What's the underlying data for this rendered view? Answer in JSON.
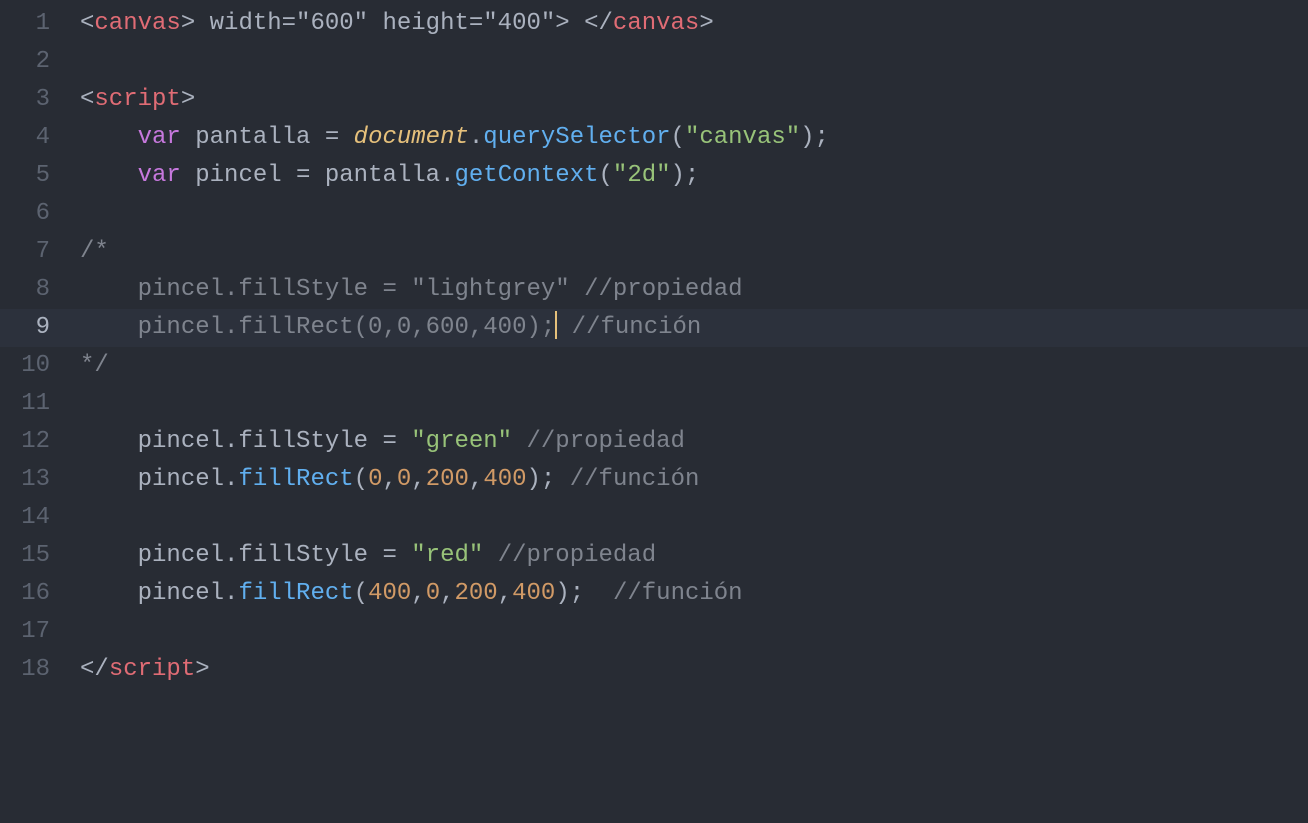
{
  "editor": {
    "activeLine": 9,
    "lines": [
      {
        "num": "1",
        "tokens": [
          {
            "cls": "t-punct",
            "text": "<"
          },
          {
            "cls": "t-tag",
            "text": "canvas"
          },
          {
            "cls": "t-punct",
            "text": ">"
          },
          {
            "cls": "t-default",
            "text": " width=\"600\" height=\"400\"> "
          },
          {
            "cls": "t-punct",
            "text": "</"
          },
          {
            "cls": "t-tag",
            "text": "canvas"
          },
          {
            "cls": "t-punct",
            "text": ">"
          }
        ]
      },
      {
        "num": "2",
        "tokens": []
      },
      {
        "num": "3",
        "tokens": [
          {
            "cls": "t-punct",
            "text": "<"
          },
          {
            "cls": "t-tag",
            "text": "script"
          },
          {
            "cls": "t-punct",
            "text": ">"
          }
        ]
      },
      {
        "num": "4",
        "tokens": [
          {
            "cls": "t-default",
            "text": "    "
          },
          {
            "cls": "t-keyword",
            "text": "var"
          },
          {
            "cls": "t-default",
            "text": " pantalla "
          },
          {
            "cls": "t-punct",
            "text": "="
          },
          {
            "cls": "t-default",
            "text": " "
          },
          {
            "cls": "t-builtin",
            "text": "document"
          },
          {
            "cls": "t-punct",
            "text": "."
          },
          {
            "cls": "t-method",
            "text": "querySelector"
          },
          {
            "cls": "t-punct",
            "text": "("
          },
          {
            "cls": "t-string",
            "text": "\"canvas\""
          },
          {
            "cls": "t-punct",
            "text": ");"
          }
        ]
      },
      {
        "num": "5",
        "tokens": [
          {
            "cls": "t-default",
            "text": "    "
          },
          {
            "cls": "t-keyword",
            "text": "var"
          },
          {
            "cls": "t-default",
            "text": " pincel "
          },
          {
            "cls": "t-punct",
            "text": "="
          },
          {
            "cls": "t-default",
            "text": " pantalla"
          },
          {
            "cls": "t-punct",
            "text": "."
          },
          {
            "cls": "t-method",
            "text": "getContext"
          },
          {
            "cls": "t-punct",
            "text": "("
          },
          {
            "cls": "t-string",
            "text": "\"2d\""
          },
          {
            "cls": "t-punct",
            "text": ");"
          }
        ]
      },
      {
        "num": "6",
        "tokens": []
      },
      {
        "num": "7",
        "tokens": [
          {
            "cls": "t-comment",
            "text": "/*"
          }
        ]
      },
      {
        "num": "8",
        "tokens": [
          {
            "cls": "t-comment",
            "text": "    pincel.fillStyle = \"lightgrey\" //propiedad"
          }
        ]
      },
      {
        "num": "9",
        "cursorAfter": 5,
        "tokens": [
          {
            "cls": "t-comment",
            "text": "    pincel.fillRect(0,0,600,400);"
          },
          {
            "cls": "cursor",
            "text": ""
          },
          {
            "cls": "t-comment",
            "text": " //función"
          }
        ]
      },
      {
        "num": "10",
        "tokens": [
          {
            "cls": "t-comment",
            "text": "*/"
          }
        ]
      },
      {
        "num": "11",
        "tokens": []
      },
      {
        "num": "12",
        "tokens": [
          {
            "cls": "t-default",
            "text": "    pincel.fillStyle "
          },
          {
            "cls": "t-punct",
            "text": "="
          },
          {
            "cls": "t-default",
            "text": " "
          },
          {
            "cls": "t-string",
            "text": "\"green\""
          },
          {
            "cls": "t-default",
            "text": " "
          },
          {
            "cls": "t-comment",
            "text": "//propiedad"
          }
        ]
      },
      {
        "num": "13",
        "tokens": [
          {
            "cls": "t-default",
            "text": "    pincel"
          },
          {
            "cls": "t-punct",
            "text": "."
          },
          {
            "cls": "t-method",
            "text": "fillRect"
          },
          {
            "cls": "t-punct",
            "text": "("
          },
          {
            "cls": "t-number",
            "text": "0"
          },
          {
            "cls": "t-punct",
            "text": ","
          },
          {
            "cls": "t-number",
            "text": "0"
          },
          {
            "cls": "t-punct",
            "text": ","
          },
          {
            "cls": "t-number",
            "text": "200"
          },
          {
            "cls": "t-punct",
            "text": ","
          },
          {
            "cls": "t-number",
            "text": "400"
          },
          {
            "cls": "t-punct",
            "text": "); "
          },
          {
            "cls": "t-comment",
            "text": "//función"
          }
        ]
      },
      {
        "num": "14",
        "tokens": []
      },
      {
        "num": "15",
        "tokens": [
          {
            "cls": "t-default",
            "text": "    pincel.fillStyle "
          },
          {
            "cls": "t-punct",
            "text": "="
          },
          {
            "cls": "t-default",
            "text": " "
          },
          {
            "cls": "t-string",
            "text": "\"red\""
          },
          {
            "cls": "t-default",
            "text": " "
          },
          {
            "cls": "t-comment",
            "text": "//propiedad"
          }
        ]
      },
      {
        "num": "16",
        "tokens": [
          {
            "cls": "t-default",
            "text": "    pincel"
          },
          {
            "cls": "t-punct",
            "text": "."
          },
          {
            "cls": "t-method",
            "text": "fillRect"
          },
          {
            "cls": "t-punct",
            "text": "("
          },
          {
            "cls": "t-number",
            "text": "400"
          },
          {
            "cls": "t-punct",
            "text": ","
          },
          {
            "cls": "t-number",
            "text": "0"
          },
          {
            "cls": "t-punct",
            "text": ","
          },
          {
            "cls": "t-number",
            "text": "200"
          },
          {
            "cls": "t-punct",
            "text": ","
          },
          {
            "cls": "t-number",
            "text": "400"
          },
          {
            "cls": "t-punct",
            "text": ");  "
          },
          {
            "cls": "t-comment",
            "text": "//función"
          }
        ]
      },
      {
        "num": "17",
        "tokens": []
      },
      {
        "num": "18",
        "tokens": [
          {
            "cls": "t-punct",
            "text": "</"
          },
          {
            "cls": "t-tag",
            "text": "script"
          },
          {
            "cls": "t-punct",
            "text": ">"
          }
        ]
      }
    ]
  }
}
